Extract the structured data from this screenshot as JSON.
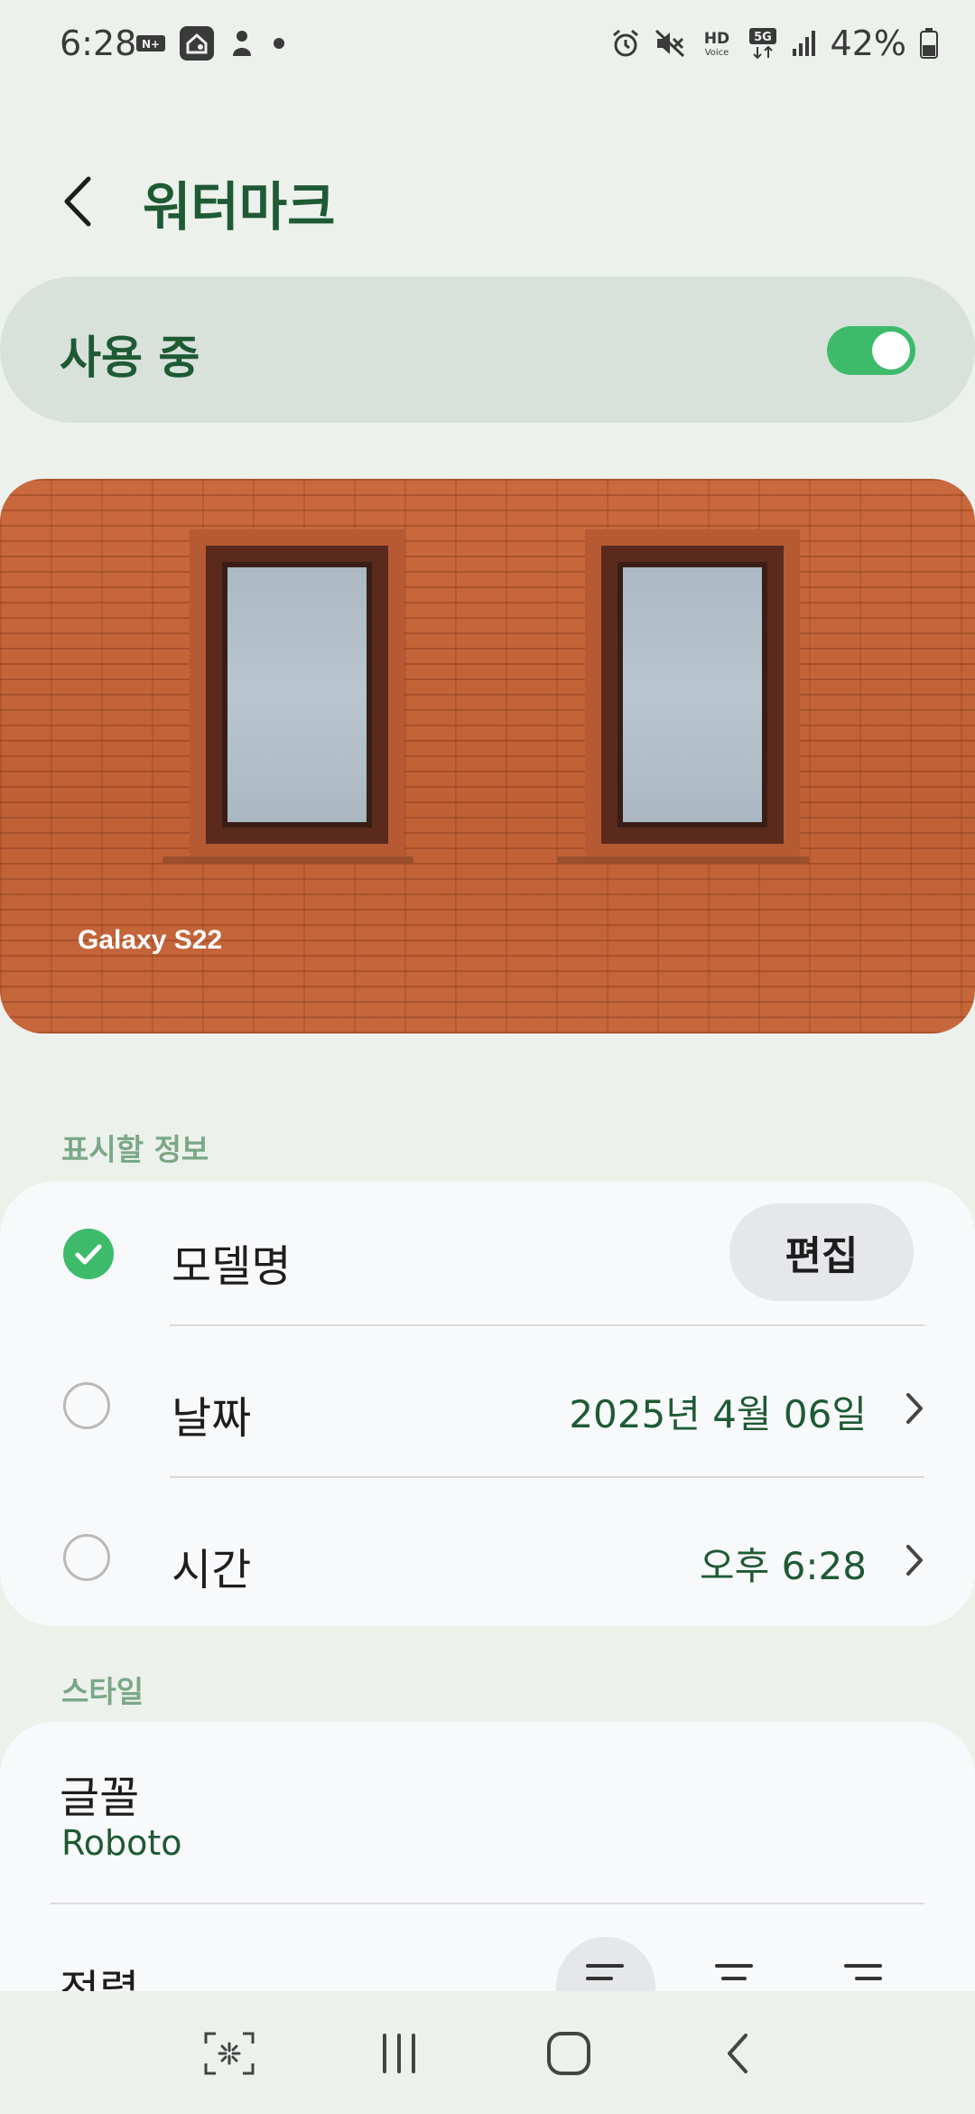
{
  "status_bar": {
    "time": "6:28",
    "left_icons": [
      "nplus-icon",
      "home-app-icon",
      "bixby-icon",
      "dot-icon"
    ],
    "right_icons": [
      "alarm-icon",
      "mute-icon",
      "hd-voice-icon",
      "5g-icon",
      "signal-icon"
    ],
    "battery": "42%"
  },
  "app_bar": {
    "title": "워터마크"
  },
  "master_toggle": {
    "label": "사용 중",
    "on": true
  },
  "preview": {
    "watermark_text": "Galaxy S22"
  },
  "info_section": {
    "header": "표시할 정보",
    "rows": [
      {
        "label": "모델명",
        "checked": true,
        "action": "편집"
      },
      {
        "label": "날짜",
        "checked": false,
        "value": "2025년 4월 06일"
      },
      {
        "label": "시간",
        "checked": false,
        "value": "오후 6:28"
      }
    ]
  },
  "style_section": {
    "header": "스타일",
    "font": {
      "label": "글꼴",
      "value": "Roboto"
    },
    "alignment": {
      "label": "정렬",
      "options": [
        "align-left-icon",
        "align-center-icon",
        "align-right-icon"
      ],
      "selected": 0
    }
  },
  "nav_bar": {
    "items": [
      "screenshot-capture-icon",
      "recent-apps-icon",
      "home-icon",
      "back-icon"
    ]
  },
  "colors": {
    "accent": "#3dbb6a",
    "title_green": "#1e5a34",
    "section_header": "#7aa887",
    "background": "#ecf1ec"
  }
}
